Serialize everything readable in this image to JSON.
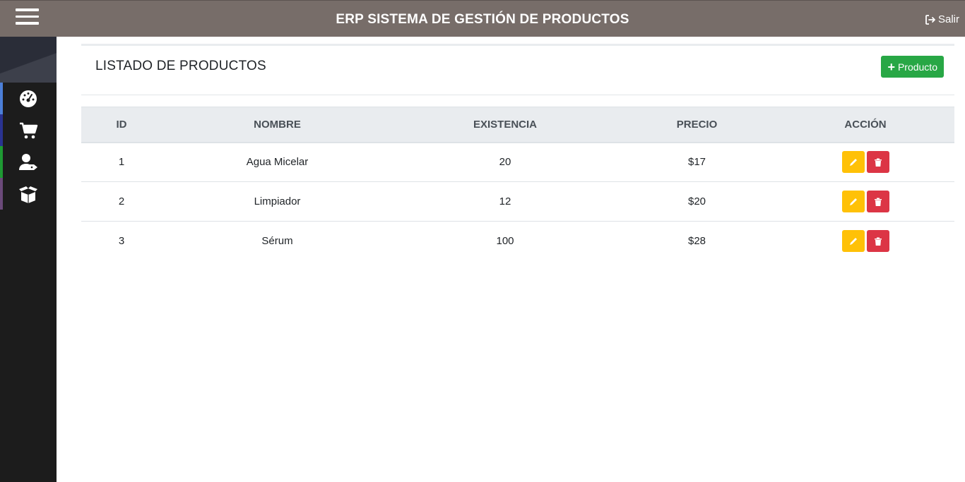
{
  "header": {
    "title": "ERP SISTEMA DE GESTIÓN DE PRODUCTOS",
    "logout_label": "Salir",
    "color": "#776d69"
  },
  "sidebar": {
    "items": [
      {
        "icon": "dashboard-icon",
        "accent": "#4c7fd8"
      },
      {
        "icon": "cart-icon",
        "accent": "#2a3391"
      },
      {
        "icon": "user-tag-icon",
        "accent": "#1e9a33"
      },
      {
        "icon": "box-open-icon",
        "accent": "#6b4a7a"
      }
    ]
  },
  "main": {
    "title": "LISTADO DE PRODUCTOS",
    "add_button_label": "Producto",
    "table": {
      "columns": [
        "ID",
        "NOMBRE",
        "EXISTENCIA",
        "PRECIO",
        "ACCIÓN"
      ],
      "rows": [
        {
          "id": "1",
          "nombre": "Agua Micelar",
          "existencia": "20",
          "precio": "$17"
        },
        {
          "id": "2",
          "nombre": "Limpiador",
          "existencia": "12",
          "precio": "$20"
        },
        {
          "id": "3",
          "nombre": "Sérum",
          "existencia": "100",
          "precio": "$28"
        }
      ]
    }
  },
  "colors": {
    "success": "#28a745",
    "warning": "#ffc107",
    "danger": "#dc3545"
  }
}
